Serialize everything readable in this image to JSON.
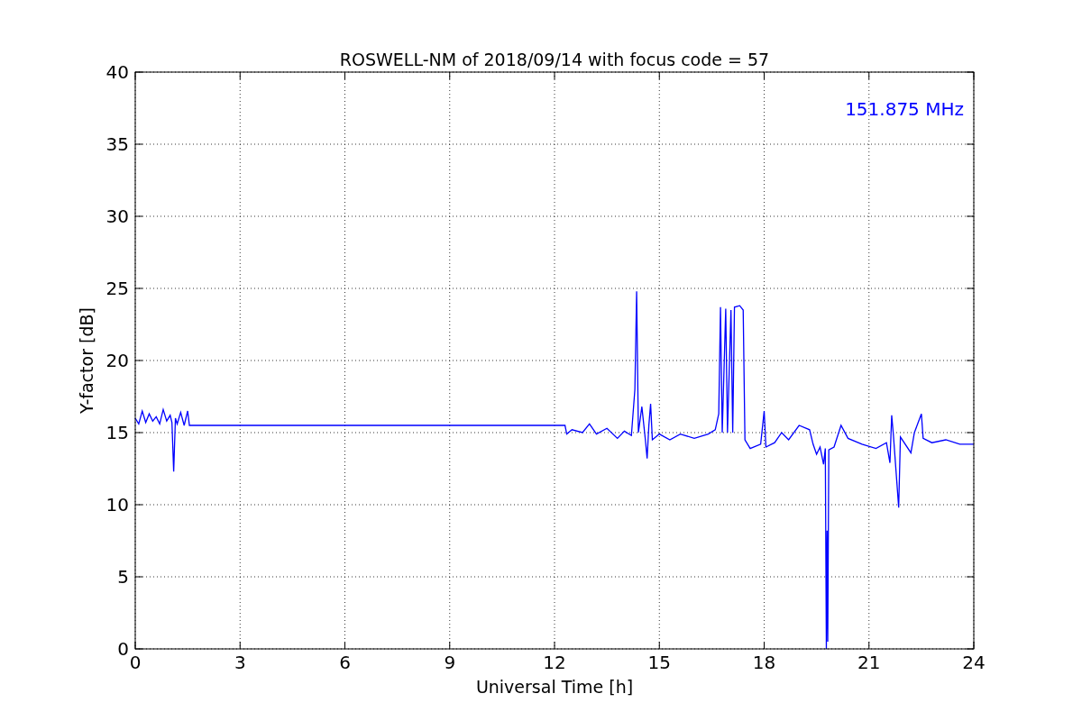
{
  "figure": {
    "chart_data": {
      "type": "line",
      "title": "ROSWELL-NM of 2018/09/14 with focus code = 57",
      "xlabel": "Universal Time [h]",
      "ylabel": "Y-factor [dB]",
      "x": [
        0,
        0.1,
        0.2,
        0.3,
        0.4,
        0.5,
        0.6,
        0.7,
        0.8,
        0.9,
        1.0,
        1.05,
        1.1,
        1.15,
        1.2,
        1.3,
        1.4,
        1.5,
        1.55,
        12.3,
        12.35,
        12.5,
        12.8,
        13.0,
        13.2,
        13.5,
        13.8,
        14.0,
        14.2,
        14.3,
        14.35,
        14.4,
        14.5,
        14.6,
        14.65,
        14.7,
        14.75,
        14.8,
        15.0,
        15.3,
        15.6,
        16.0,
        16.4,
        16.6,
        16.7,
        16.75,
        16.8,
        16.9,
        16.95,
        17.05,
        17.1,
        17.15,
        17.3,
        17.4,
        17.45,
        17.6,
        17.9,
        18.0,
        18.05,
        18.3,
        18.5,
        18.7,
        19.0,
        19.3,
        19.4,
        19.5,
        19.6,
        19.7,
        19.75,
        19.78,
        19.8,
        19.82,
        19.85,
        20.0,
        20.2,
        20.4,
        20.8,
        21.2,
        21.5,
        21.6,
        21.65,
        21.7,
        21.85,
        21.9,
        22.2,
        22.3,
        22.5,
        22.55,
        22.8,
        23.2,
        23.6,
        24
      ],
      "series": [
        {
          "name": "151.875 MHz",
          "color": "#0000ff",
          "values": [
            16,
            15.6,
            16.5,
            15.7,
            16.3,
            15.8,
            16.1,
            15.6,
            16.6,
            15.8,
            16.2,
            15.7,
            12.3,
            16,
            15.6,
            16.4,
            15.5,
            16.5,
            15.5,
            15.5,
            14.9,
            15.2,
            15,
            15.6,
            14.9,
            15.3,
            14.6,
            15.1,
            14.8,
            18,
            24.8,
            15,
            16.8,
            14.5,
            13.2,
            15.5,
            17,
            14.5,
            14.9,
            14.5,
            14.9,
            14.6,
            14.9,
            15.2,
            16.3,
            23.7,
            15,
            23.6,
            15,
            23.5,
            15,
            23.7,
            23.8,
            23.5,
            14.5,
            13.9,
            14.2,
            16.5,
            14,
            14.3,
            15,
            14.5,
            15.5,
            15.2,
            14.2,
            13.5,
            14,
            12.8,
            13.9,
            0,
            8.2,
            0.5,
            13.8,
            14,
            15.5,
            14.6,
            14.2,
            13.9,
            14.3,
            12.9,
            16.2,
            14.8,
            9.8,
            14.7,
            13.6,
            15,
            16.3,
            14.6,
            14.3,
            14.5,
            14.2,
            14.2
          ]
        }
      ],
      "xlim": [
        0,
        24
      ],
      "ylim": [
        0,
        40
      ],
      "xticks": [
        0,
        3,
        6,
        9,
        12,
        15,
        18,
        21,
        24
      ],
      "yticks": [
        0,
        5,
        10,
        15,
        20,
        25,
        30,
        35,
        40
      ],
      "grid": true
    }
  }
}
